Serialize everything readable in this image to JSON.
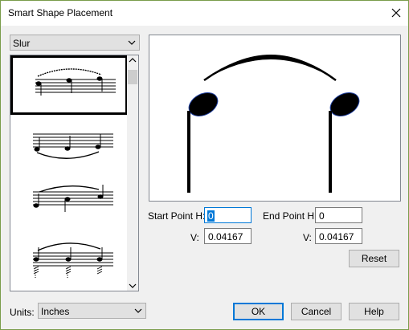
{
  "window": {
    "title": "Smart Shape Placement"
  },
  "shape_select": {
    "value": "Slur"
  },
  "shape_list": {
    "items": [
      "Slur above",
      "Slur below",
      "Slur above stems",
      "Slur with grace notes"
    ],
    "selected_index": 0
  },
  "preview": {
    "description": ""
  },
  "start_point": {
    "h_label": "Start Point H:",
    "h_value": "0",
    "v_label": "V:",
    "v_value": "0.04167"
  },
  "end_point": {
    "h_label": "End Point H:",
    "h_value": "0",
    "v_label": "V:",
    "v_value": "0.04167"
  },
  "buttons": {
    "reset": "Reset",
    "ok": "OK",
    "cancel": "Cancel",
    "help": "Help"
  },
  "units": {
    "label": "Units:",
    "value": "Inches"
  }
}
